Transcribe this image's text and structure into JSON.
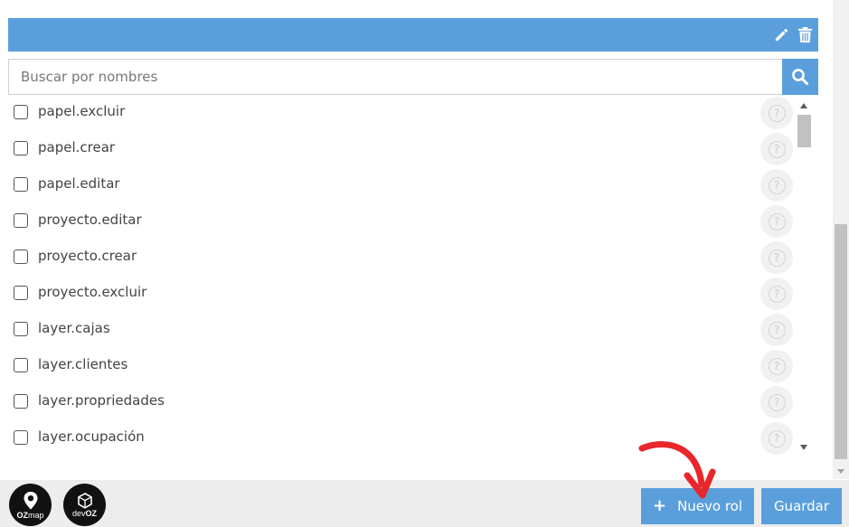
{
  "header": {
    "edit_icon": "pencil-icon",
    "delete_icon": "trash-icon"
  },
  "search": {
    "value": "",
    "placeholder": "Buscar por nombres",
    "button_icon": "search-icon"
  },
  "permissions": [
    {
      "label": "papel.excluir",
      "checked": false
    },
    {
      "label": "papel.crear",
      "checked": false
    },
    {
      "label": "papel.editar",
      "checked": false
    },
    {
      "label": "proyecto.editar",
      "checked": false
    },
    {
      "label": "proyecto.crear",
      "checked": false
    },
    {
      "label": "proyecto.excluir",
      "checked": false
    },
    {
      "label": "layer.cajas",
      "checked": false
    },
    {
      "label": "layer.clientes",
      "checked": false
    },
    {
      "label": "layer.propriedades",
      "checked": false
    },
    {
      "label": "layer.ocupación",
      "checked": false
    }
  ],
  "help_glyph": "?",
  "footer": {
    "logos": [
      {
        "name": "OZmap",
        "prefix": "OZ",
        "suffix": "map"
      },
      {
        "name": "devOZ",
        "prefix": "dev",
        "suffix": "OZ"
      }
    ],
    "new_role_label": "Nuevo rol",
    "new_role_icon": "plus-icon",
    "save_label": "Guardar"
  },
  "colors": {
    "accent": "#5a9fdc",
    "footer_bg": "#ededed",
    "annotation_arrow": "#e8262b"
  }
}
